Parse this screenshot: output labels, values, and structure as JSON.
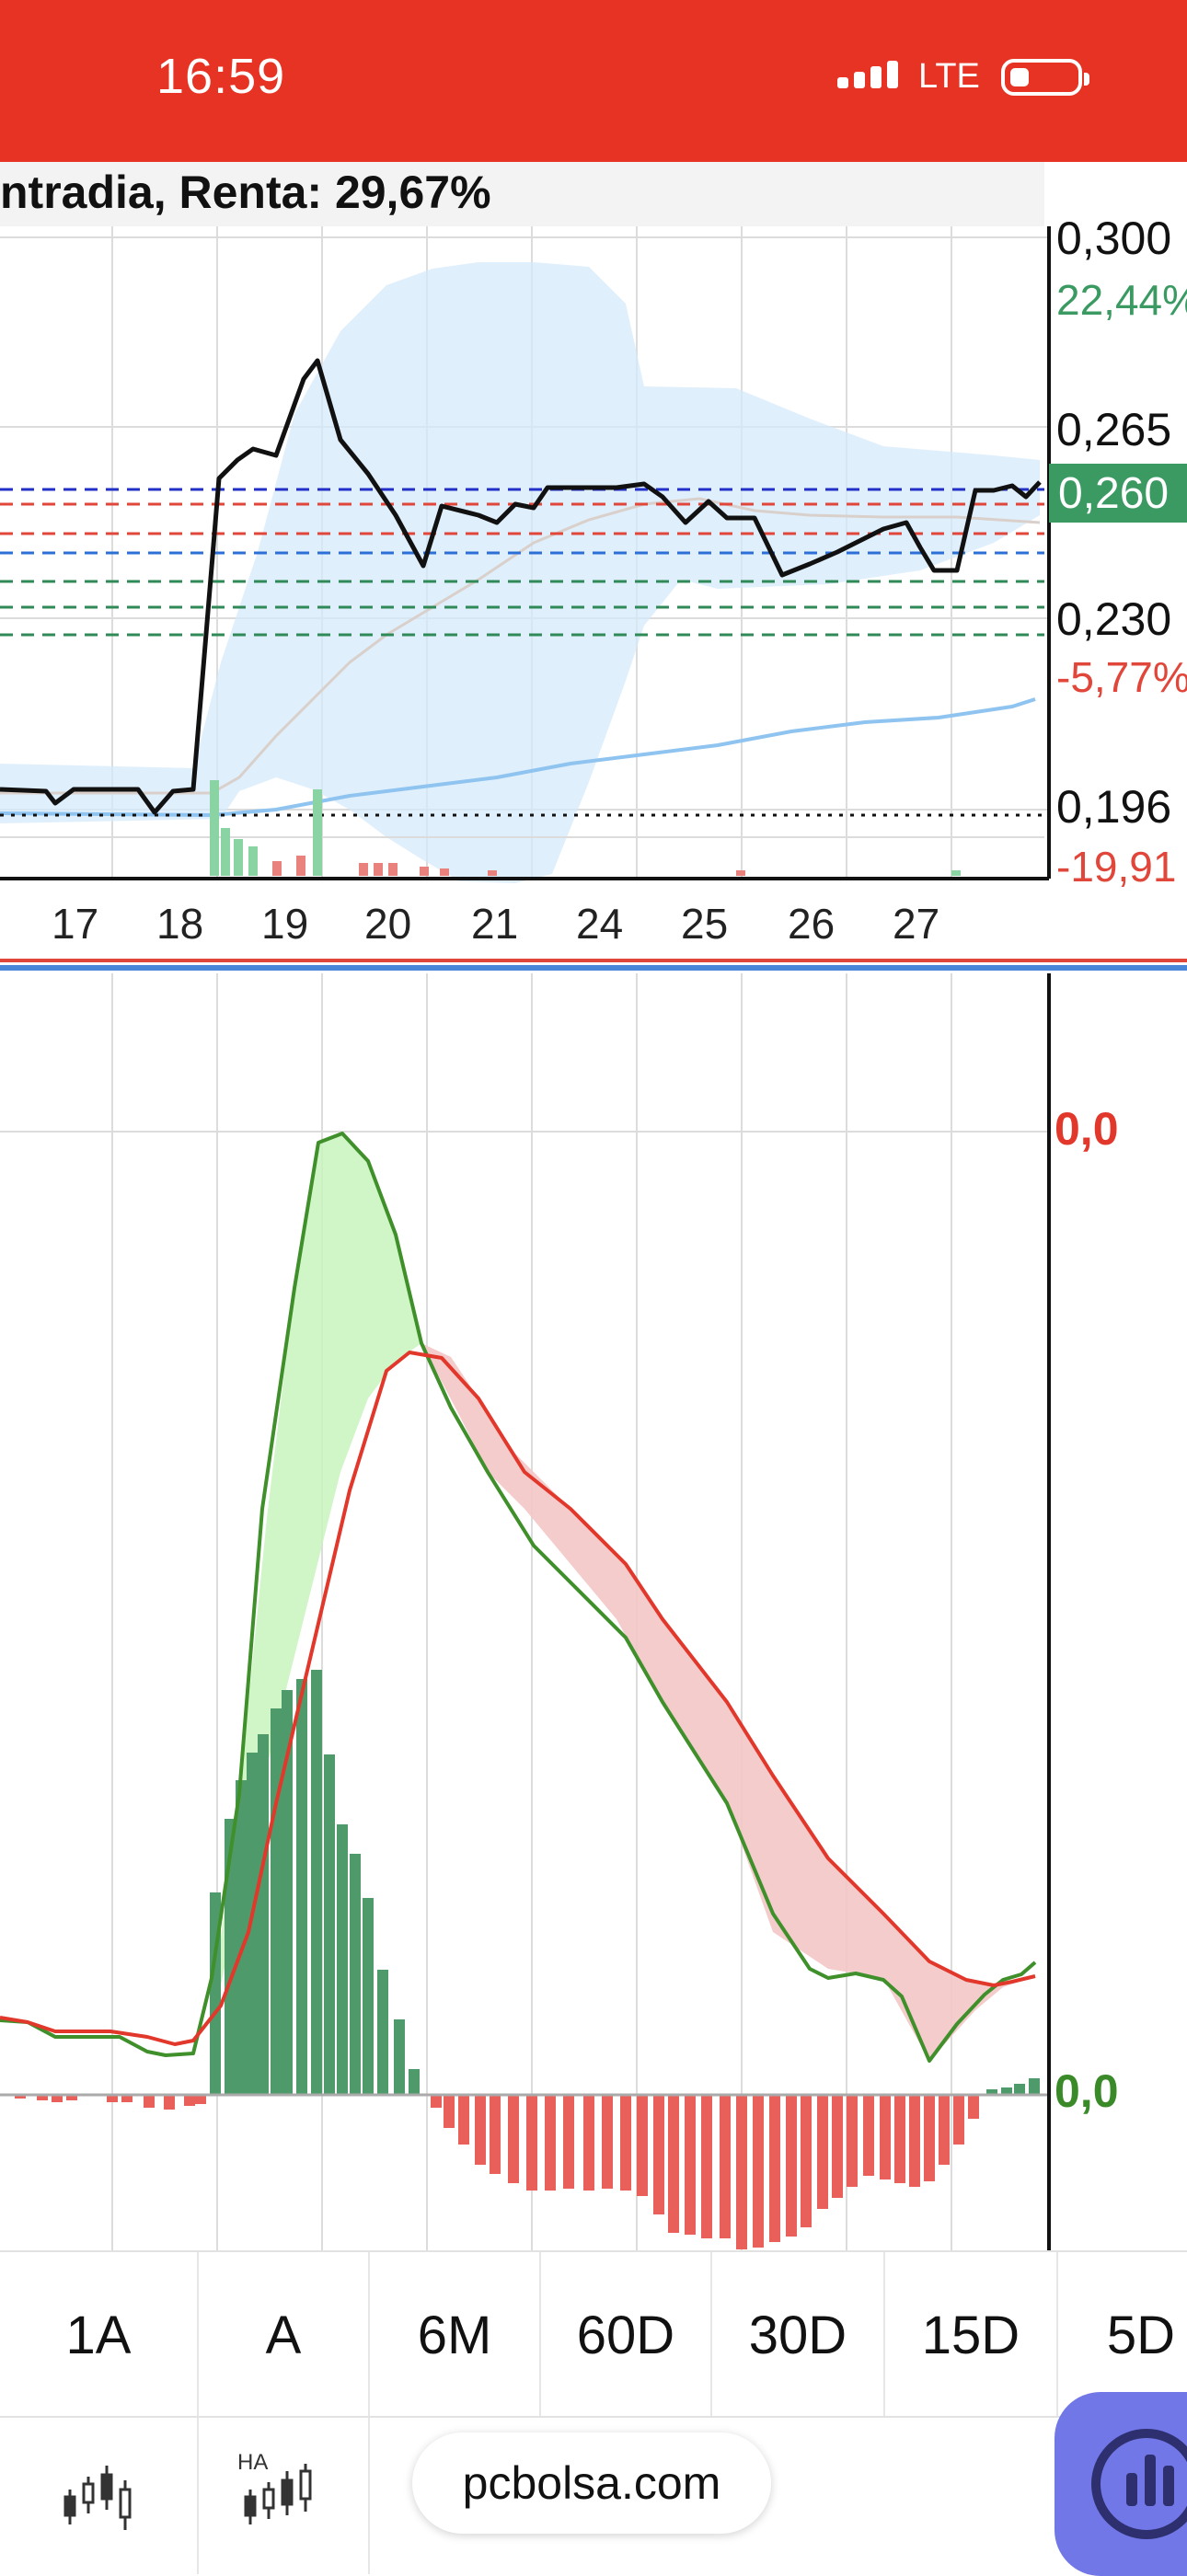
{
  "status_bar": {
    "time": "16:59",
    "network": "LTE"
  },
  "chart_title": "ntradia, Renta: 29,67%",
  "price_axis": {
    "top": "0,300",
    "top_pct": "22,44%",
    "upper": "0,265",
    "current": "0,260",
    "lower": "0,230",
    "lower_pct": "-5,77%",
    "bottom": "0,196",
    "bottom_pct": "-19,91"
  },
  "date_labels": [
    "17",
    "18",
    "19",
    "20",
    "21",
    "24",
    "25",
    "26",
    "27"
  ],
  "indicator_axis": {
    "top": "0,0",
    "bottom": "0,0"
  },
  "timeframes": [
    "1A",
    "A",
    "6M",
    "60D",
    "30D",
    "15D",
    "5D"
  ],
  "footer": {
    "url": "pcbolsa.com",
    "candle_icon": "candlestick-icon",
    "ha_icon": "heikin-ashi-icon",
    "ha_label": "HA"
  },
  "colors": {
    "status_bar": "#e63323",
    "price_line": "#111111",
    "bollinger": "#d6e9fb",
    "macd_line": "#3f8f2a",
    "signal_line": "#e2372b",
    "hist_pos": "#4f9a6b",
    "hist_neg": "#e9605a",
    "current_price_badge": "#3a9a62"
  },
  "chart_data": [
    {
      "type": "line",
      "x": [
        "17",
        "18",
        "19",
        "20",
        "21",
        "24",
        "25",
        "26",
        "27"
      ],
      "series": [
        {
          "values": [
            0.196,
            0.199,
            0.27,
            0.255,
            0.252,
            0.259,
            0.25,
            0.252,
            0.258
          ]
        }
      ],
      "ylim": [
        0.188,
        0.3
      ],
      "reference_lines": [
        0.26,
        0.258,
        0.254,
        0.25,
        0.245,
        0.241,
        0.236,
        0.196
      ]
    },
    {
      "type": "line",
      "x": [
        "17",
        "18",
        "19",
        "20",
        "21",
        "24",
        "25",
        "26",
        "27"
      ],
      "series": [
        {
          "values": [
            0.3,
            0.2,
            8.9,
            6.6,
            5.1,
            3.5,
            1.4,
            0.5,
            1.0
          ]
        },
        {
          "values": [
            0.4,
            0.3,
            5.5,
            7.0,
            6.1,
            4.8,
            3.0,
            1.3,
            0.6
          ]
        }
      ]
    }
  ]
}
